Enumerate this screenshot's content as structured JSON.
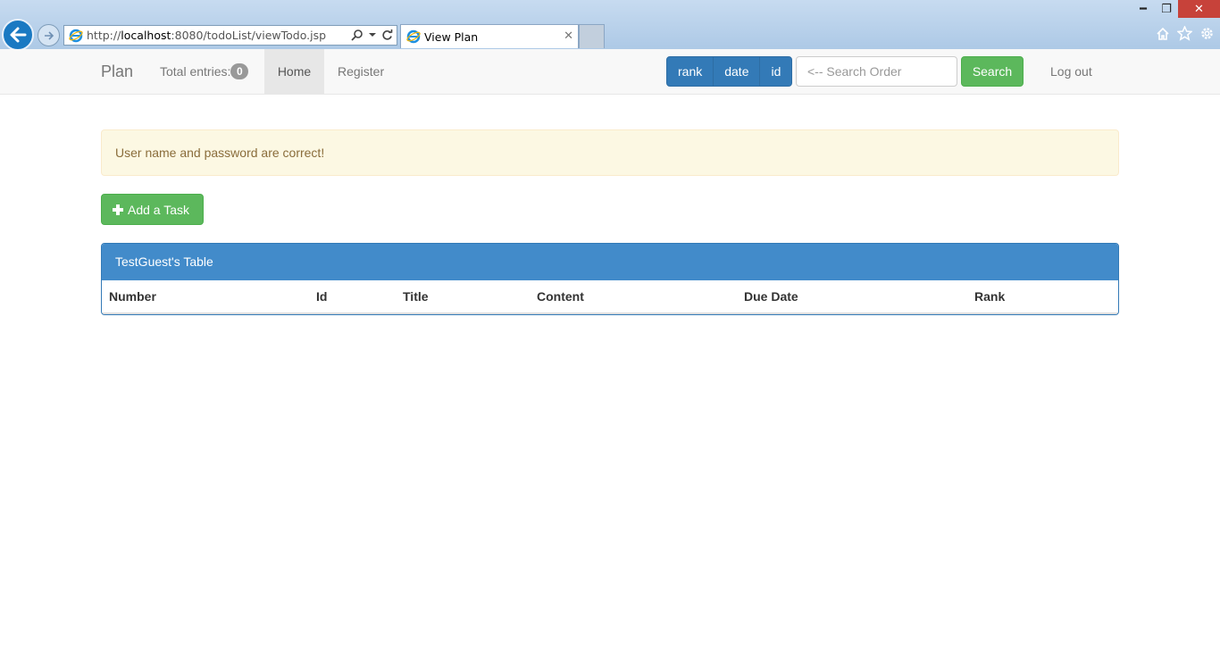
{
  "browser": {
    "url_prefix": "http://",
    "url_host": "localhost",
    "url_rest": ":8080/todoList/viewTodo.jsp",
    "tab_title": "View Plan",
    "window_controls": [
      "minimize",
      "restore",
      "close"
    ]
  },
  "navbar": {
    "brand": "Plan",
    "total_label": "Total entries:",
    "total_count": "0",
    "home": "Home",
    "register": "Register",
    "sort_buttons": [
      "rank",
      "date",
      "id"
    ],
    "search_placeholder": "<-- Search Order",
    "search_button": "Search",
    "logout": "Log out"
  },
  "alert": {
    "message": "User name and password are correct!"
  },
  "actions": {
    "add_task": "Add a Task"
  },
  "table": {
    "title": "TestGuest's Table",
    "columns": [
      "Number",
      "Id",
      "Title",
      "Content",
      "Due Date",
      "Rank"
    ],
    "rows": []
  },
  "colors": {
    "primary": "#337ab7",
    "success": "#5cb85c",
    "warning_bg": "#fcf8e3",
    "warning_text": "#8a6d3b",
    "panel_heading": "#428bca"
  }
}
